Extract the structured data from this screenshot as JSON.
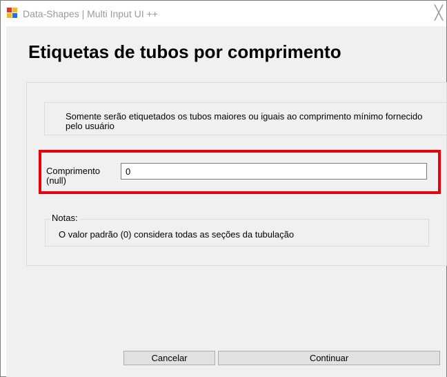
{
  "window": {
    "title": "Data-Shapes | Multi Input UI ++",
    "close_glyph": "╳",
    "app_icon": "window-app-icon"
  },
  "page": {
    "title": "Etiquetas de tubos por comprimento"
  },
  "info": {
    "text": "Somente serão etiquetados os tubos maiores ou iguais ao comprimento mínimo fornecido pelo usuário"
  },
  "form": {
    "comprimento_label_line1": "Comprimento",
    "comprimento_label_line2": "(null)",
    "comprimento_value": "0",
    "highlight_color": "#e8000a"
  },
  "notes": {
    "title": "Notas:",
    "text": "O valor padrão (0) considera todas as seções da tubulação"
  },
  "buttons": {
    "cancel": "Cancelar",
    "continue": "Continuar"
  }
}
